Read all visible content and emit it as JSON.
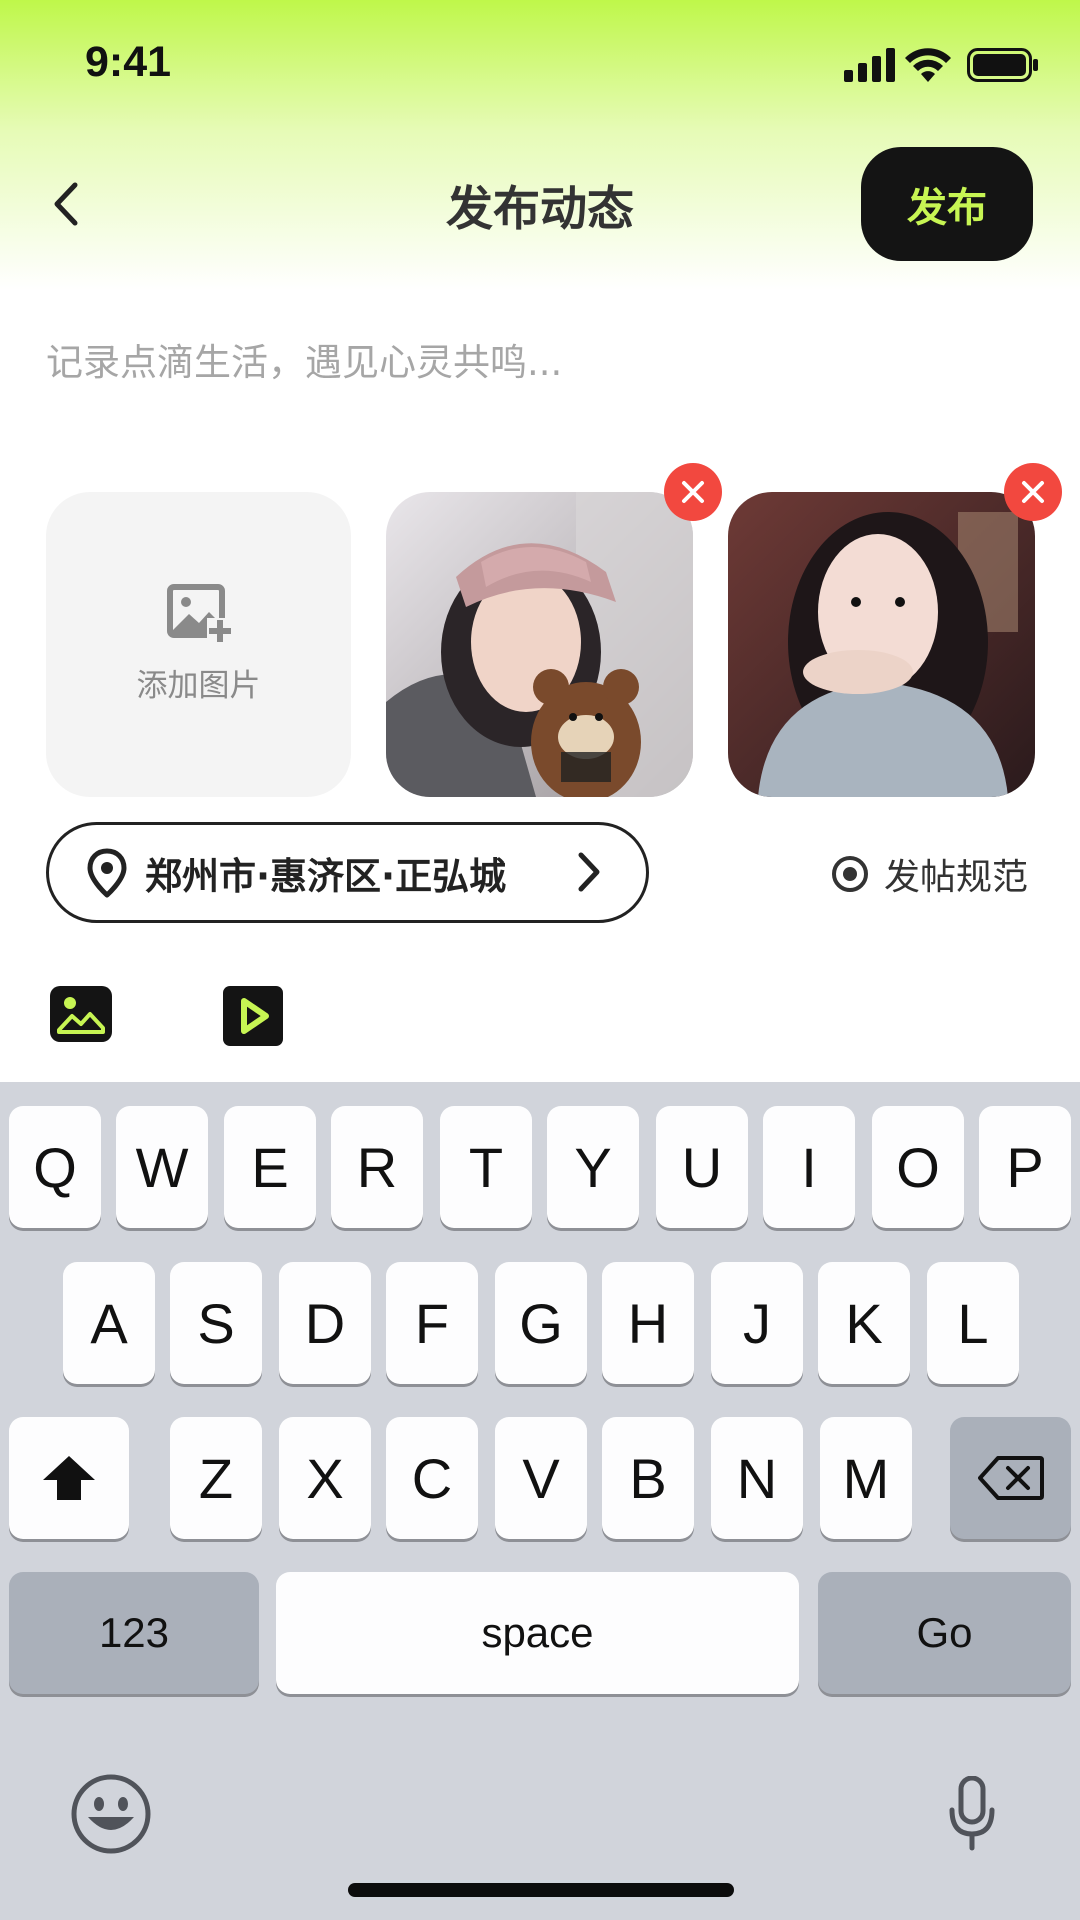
{
  "status_bar": {
    "time": "9:41"
  },
  "header": {
    "title": "发布动态",
    "publish_label": "发布"
  },
  "compose": {
    "placeholder": "记录点滴生活，遇见心灵共鸣..."
  },
  "media": {
    "add_image_label": "添加图片"
  },
  "location": {
    "text": "郑州市·惠济区·正弘城"
  },
  "rules": {
    "label": "发帖规范"
  },
  "keyboard": {
    "row1": [
      "Q",
      "W",
      "E",
      "R",
      "T",
      "Y",
      "U",
      "I",
      "O",
      "P"
    ],
    "row2": [
      "A",
      "S",
      "D",
      "F",
      "G",
      "H",
      "J",
      "K",
      "L"
    ],
    "row3": [
      "Z",
      "X",
      "C",
      "V",
      "B",
      "N",
      "M"
    ],
    "numbers_label": "123",
    "space_label": "space",
    "go_label": "Go"
  },
  "colors": {
    "accent": "#c7f553",
    "button_dark": "#141414",
    "remove": "#f2483f"
  }
}
